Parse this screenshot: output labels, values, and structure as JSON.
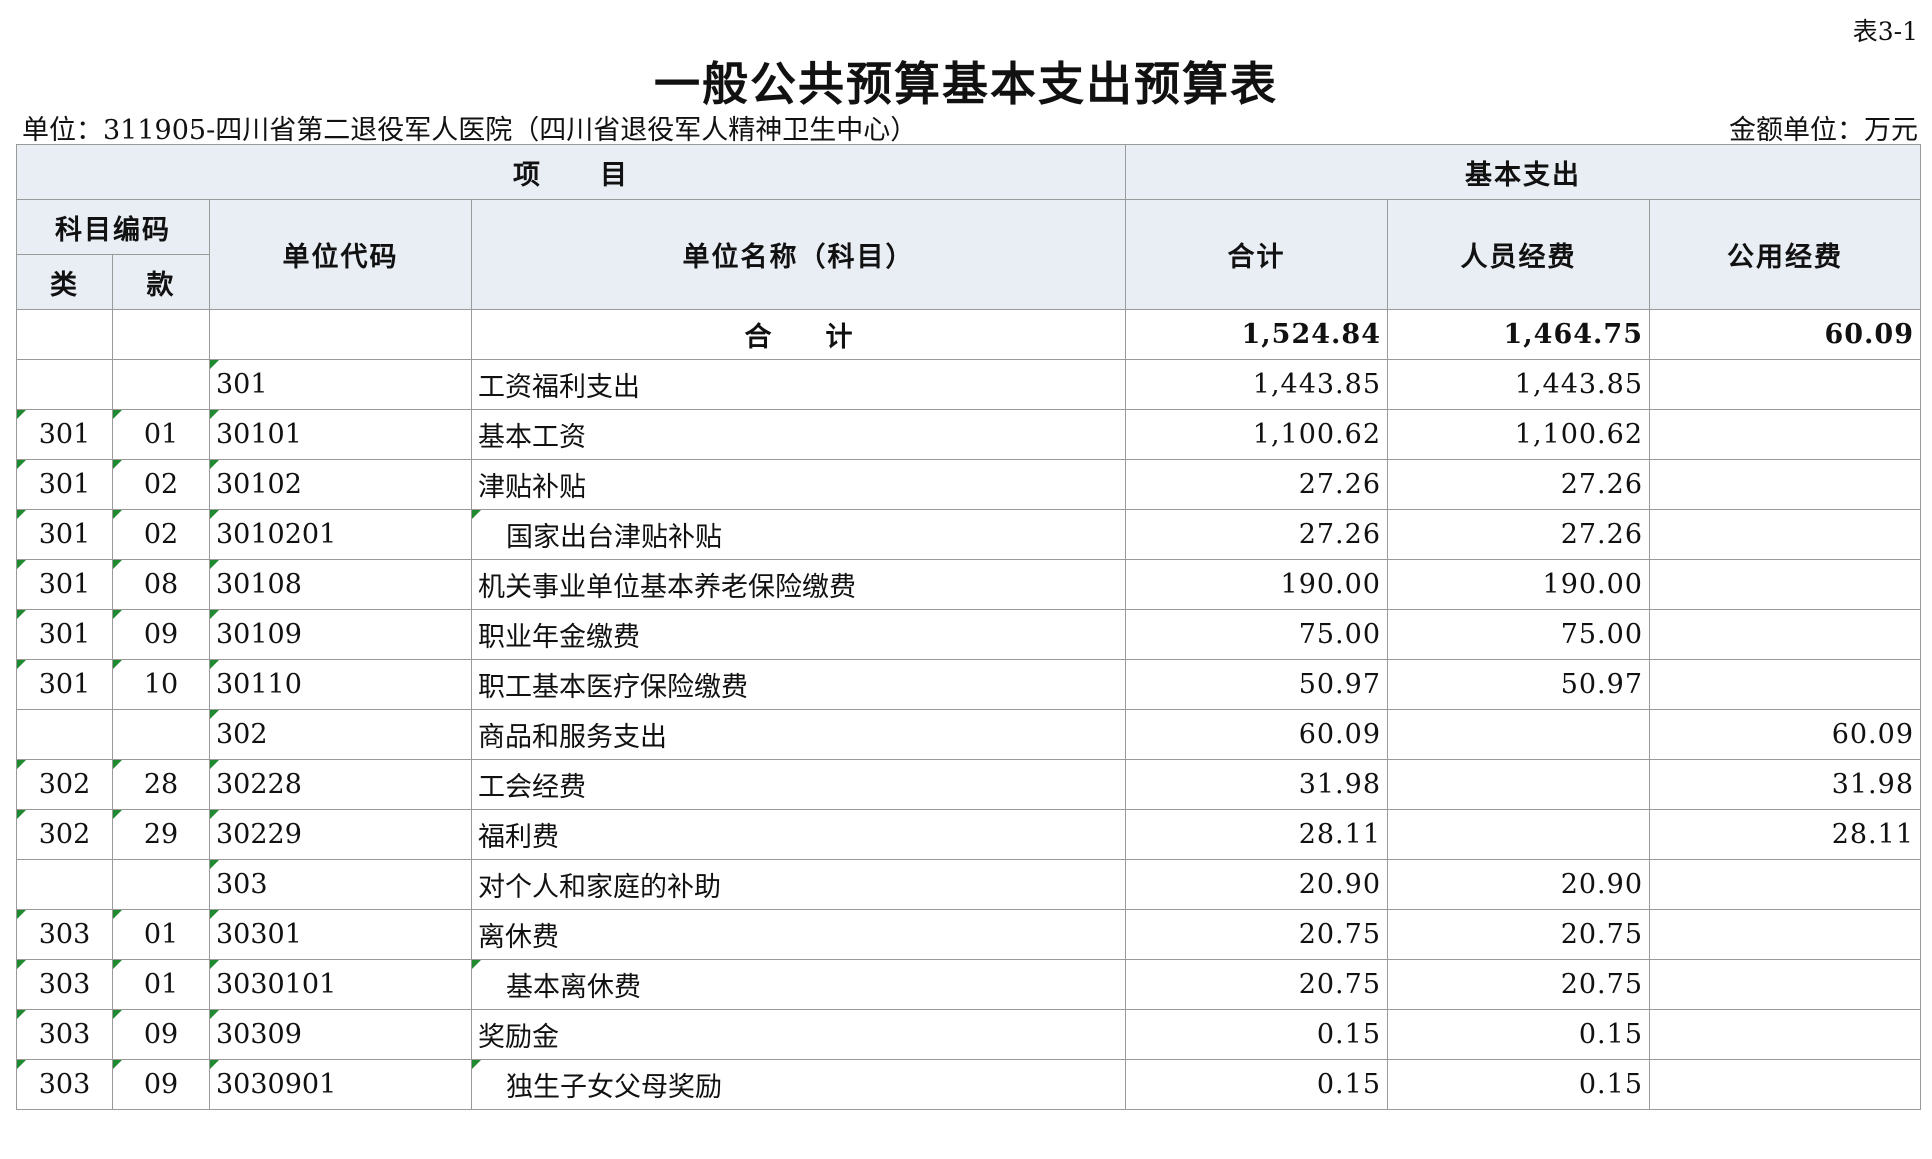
{
  "table_no": "表3-1",
  "title": "一般公共预算基本支出预算表",
  "unit_left": "单位：311905-四川省第二退役军人医院（四川省退役军人精神卫生中心）",
  "unit_right": "金额单位：万元",
  "header": {
    "project": "项　　目",
    "basic_expense": "基本支出",
    "subject_code": "科目编码",
    "category": "类",
    "section": "款",
    "unit_code": "单位代码",
    "unit_name": "单位名称（科目）",
    "total": "合计",
    "personnel": "人员经费",
    "public": "公用经费"
  },
  "total_row": {
    "label": "合　　计",
    "total": "1,524.84",
    "personnel": "1,464.75",
    "public": "60.09"
  },
  "rows": [
    {
      "lei": "",
      "kuan": "",
      "code": "301",
      "name": "工资福利支出",
      "total": "1,443.85",
      "personnel": "1,443.85",
      "public": "",
      "indent": false
    },
    {
      "lei": "301",
      "kuan": "01",
      "code": "30101",
      "name": "基本工资",
      "total": "1,100.62",
      "personnel": "1,100.62",
      "public": "",
      "indent": false
    },
    {
      "lei": "301",
      "kuan": "02",
      "code": "30102",
      "name": "津贴补贴",
      "total": "27.26",
      "personnel": "27.26",
      "public": "",
      "indent": false
    },
    {
      "lei": "301",
      "kuan": "02",
      "code": "3010201",
      "name": "国家出台津贴补贴",
      "total": "27.26",
      "personnel": "27.26",
      "public": "",
      "indent": true
    },
    {
      "lei": "301",
      "kuan": "08",
      "code": "30108",
      "name": "机关事业单位基本养老保险缴费",
      "total": "190.00",
      "personnel": "190.00",
      "public": "",
      "indent": false
    },
    {
      "lei": "301",
      "kuan": "09",
      "code": "30109",
      "name": "职业年金缴费",
      "total": "75.00",
      "personnel": "75.00",
      "public": "",
      "indent": false
    },
    {
      "lei": "301",
      "kuan": "10",
      "code": "30110",
      "name": "职工基本医疗保险缴费",
      "total": "50.97",
      "personnel": "50.97",
      "public": "",
      "indent": false
    },
    {
      "lei": "",
      "kuan": "",
      "code": "302",
      "name": "商品和服务支出",
      "total": "60.09",
      "personnel": "",
      "public": "60.09",
      "indent": false
    },
    {
      "lei": "302",
      "kuan": "28",
      "code": "30228",
      "name": "工会经费",
      "total": "31.98",
      "personnel": "",
      "public": "31.98",
      "indent": false
    },
    {
      "lei": "302",
      "kuan": "29",
      "code": "30229",
      "name": "福利费",
      "total": "28.11",
      "personnel": "",
      "public": "28.11",
      "indent": false
    },
    {
      "lei": "",
      "kuan": "",
      "code": "303",
      "name": "对个人和家庭的补助",
      "total": "20.90",
      "personnel": "20.90",
      "public": "",
      "indent": false
    },
    {
      "lei": "303",
      "kuan": "01",
      "code": "30301",
      "name": "离休费",
      "total": "20.75",
      "personnel": "20.75",
      "public": "",
      "indent": false
    },
    {
      "lei": "303",
      "kuan": "01",
      "code": "3030101",
      "name": "基本离休费",
      "total": "20.75",
      "personnel": "20.75",
      "public": "",
      "indent": true
    },
    {
      "lei": "303",
      "kuan": "09",
      "code": "30309",
      "name": "奖励金",
      "total": "0.15",
      "personnel": "0.15",
      "public": "",
      "indent": false
    },
    {
      "lei": "303",
      "kuan": "09",
      "code": "3030901",
      "name": "独生子女父母奖励",
      "total": "0.15",
      "personnel": "0.15",
      "public": "",
      "indent": true
    }
  ],
  "colors": {
    "header_bg": "#e9eef5",
    "border": "#9a9a9a",
    "marker": "#1f8a2f"
  }
}
